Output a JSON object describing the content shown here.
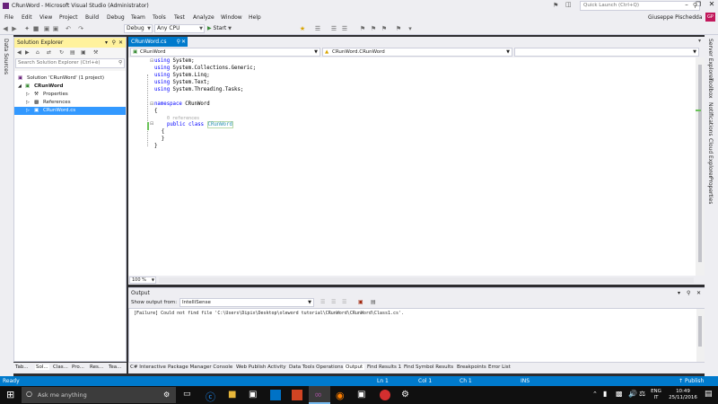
{
  "window": {
    "title": "CRunWord - Microsoft Visual Studio (Administrator)",
    "quick_launch_placeholder": "Quick Launch (Ctrl+Q)",
    "user": "Giuseppe Pischedda",
    "avatar_initials": "GP"
  },
  "menu": [
    "File",
    "Edit",
    "View",
    "Project",
    "Build",
    "Debug",
    "Team",
    "Tools",
    "Test",
    "Analyze",
    "Window",
    "Help"
  ],
  "toolbar": {
    "config": "Debug",
    "platform": "Any CPU",
    "start_label": "Start"
  },
  "left_strip": {
    "data_sources": "Data Sources"
  },
  "right_strip": [
    "Server Explorer",
    "Toolbox",
    "Notifications",
    "Cloud Explorer",
    "Properties"
  ],
  "solution_explorer": {
    "title": "Solution Explorer",
    "search_placeholder": "Search Solution Explorer (Ctrl+è)",
    "items": [
      {
        "label": "Solution 'CRunWord' (1 project)"
      },
      {
        "label": "CRunWord"
      },
      {
        "label": "Properties"
      },
      {
        "label": "References"
      },
      {
        "label": "CRunWord.cs"
      }
    ],
    "bottom_tabs": [
      "Tab...",
      "Sol...",
      "Clas...",
      "Pro...",
      "Res...",
      "Tea..."
    ]
  },
  "editor": {
    "tab_label": "CRunWord.cs",
    "nav_project": "CRunWord",
    "nav_class": "CRunWord.CRunWord",
    "zoom": "100 %",
    "lines": [
      {
        "kw": "using",
        "rest": " System;"
      },
      {
        "kw": "using",
        "rest": " System.Collections.Generic;"
      },
      {
        "kw": "using",
        "rest": " System.Linq;"
      },
      {
        "kw": "using",
        "rest": " System.Text;"
      },
      {
        "kw": "using",
        "rest": " System.Threading.Tasks;"
      },
      {
        "kw": "namespace",
        "rest": " CRunWord"
      },
      {
        "text": "{"
      },
      {
        "ref": "0 references"
      },
      {
        "kw": "public class",
        "type": "CRunWord"
      },
      {
        "text": "    {"
      },
      {
        "text": "    }"
      },
      {
        "text": "}"
      }
    ]
  },
  "output": {
    "title": "Output",
    "show_from_label": "Show output from:",
    "source": "IntelliSense",
    "message": "[Failure] Could not find file 'C:\\Users\\Dipix\\Desktop\\oleword tutorial\\CRunWord\\CRunWord\\Class1.cs'."
  },
  "bottom_tabs": [
    "C# Interactive",
    "Package Manager Console",
    "Web Publish Activity",
    "Data Tools Operations",
    "Output",
    "Find Results 1",
    "Find Symbol Results",
    "Breakpoints",
    "Error List"
  ],
  "status": {
    "ready": "Ready",
    "ln": "Ln 1",
    "col": "Col 1",
    "ch": "Ch 1",
    "ins": "INS",
    "publish": "Publish"
  },
  "taskbar": {
    "search_placeholder": "Ask me anything",
    "lang": "ENG",
    "region": "IT",
    "time": "10:49",
    "date": "25/11/2016"
  },
  "colors": {
    "accent": "#007acc",
    "selection": "#3399ff",
    "se_header": "#fff29d",
    "keyword": "#0000ff",
    "type": "#2b91af"
  }
}
